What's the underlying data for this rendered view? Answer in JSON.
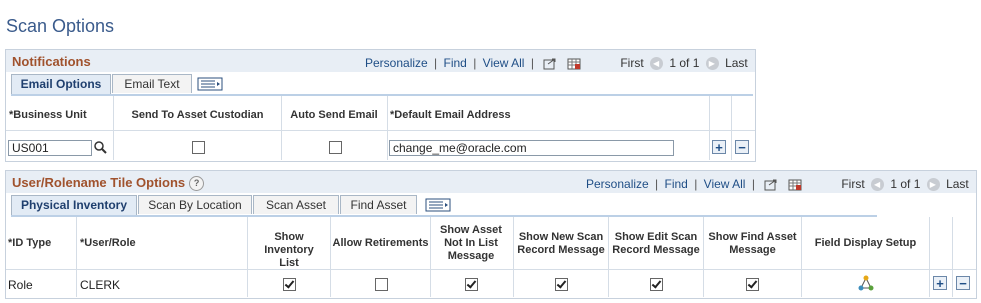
{
  "page": {
    "title": "Scan Options"
  },
  "nav": {
    "personalize": "Personalize",
    "find": "Find",
    "view_all": "View All",
    "sep": "|",
    "first": "First",
    "counter": "1 of 1",
    "last": "Last"
  },
  "notifications": {
    "title": "Notifications",
    "tabs": [
      "Email Options",
      "Email Text"
    ],
    "columns": {
      "business_unit": "*Business Unit",
      "send_custodian": "Send To Asset Custodian",
      "auto_send": "Auto Send Email",
      "default_email": "*Default Email Address"
    },
    "row": {
      "business_unit": "US001",
      "send_custodian": false,
      "auto_send": false,
      "default_email": "change_me@oracle.com"
    }
  },
  "tile_options": {
    "title": "User/Rolename Tile Options",
    "help": "?",
    "tabs": [
      "Physical Inventory",
      "Scan By Location",
      "Scan Asset",
      "Find Asset"
    ],
    "columns": {
      "id_type": "*ID Type",
      "user_role": "*User/Role",
      "show_inventory_list": "Show Inventory List",
      "allow_retirements": "Allow Retirements",
      "show_not_in_list": "Show Asset Not In List Message",
      "show_new_scan": "Show New Scan Record Message",
      "show_edit_scan": "Show Edit Scan Record Message",
      "show_find_asset": "Show Find Asset Message",
      "field_display": "Field Display Setup"
    },
    "row": {
      "id_type": "Role",
      "user_role": "CLERK",
      "show_inventory_list": true,
      "allow_retirements": false,
      "show_not_in_list": true,
      "show_new_scan": true,
      "show_edit_scan": true,
      "show_find_asset": true
    }
  },
  "buttons": {
    "add": "+",
    "delete": "−"
  },
  "icons": [
    "zoom-icon",
    "download-grid-icon",
    "prev-icon",
    "next-icon",
    "lookup-icon",
    "tab-menu-icon",
    "field-display-icon",
    "help-icon"
  ]
}
